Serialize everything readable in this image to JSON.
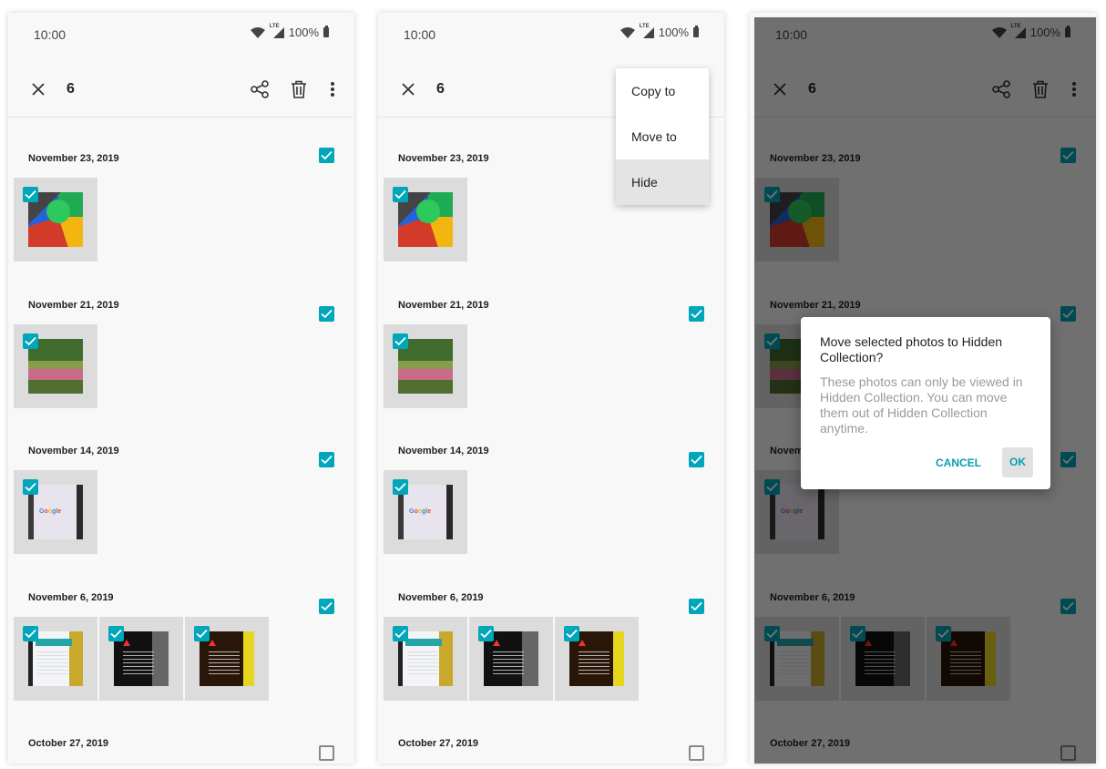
{
  "status_bar": {
    "time": "10:00",
    "network": "LTE",
    "battery": "100%"
  },
  "appbar": {
    "selected_count": "6"
  },
  "sections": [
    {
      "date": "November 23, 2019",
      "checked": true
    },
    {
      "date": "November 21, 2019",
      "checked": true
    },
    {
      "date": "November 14, 2019",
      "checked": true
    },
    {
      "date": "November 6, 2019",
      "checked": true
    },
    {
      "date": "October 27, 2019",
      "checked": false
    }
  ],
  "overflow_menu": {
    "items": [
      "Copy to",
      "Move to",
      "Hide"
    ],
    "highlighted": "Hide"
  },
  "dialog": {
    "title": "Move selected photos to Hidden Collection?",
    "body": "These photos can only be viewed in Hidden Collection. You can move them out of Hidden Collection anytime.",
    "cancel_label": "CANCEL",
    "ok_label": "OK"
  },
  "colors": {
    "accent": "#00a6b9",
    "screen_bg": "#f8f8f8",
    "thumb_bg": "#dcdcdc",
    "scrim": "#000000"
  }
}
